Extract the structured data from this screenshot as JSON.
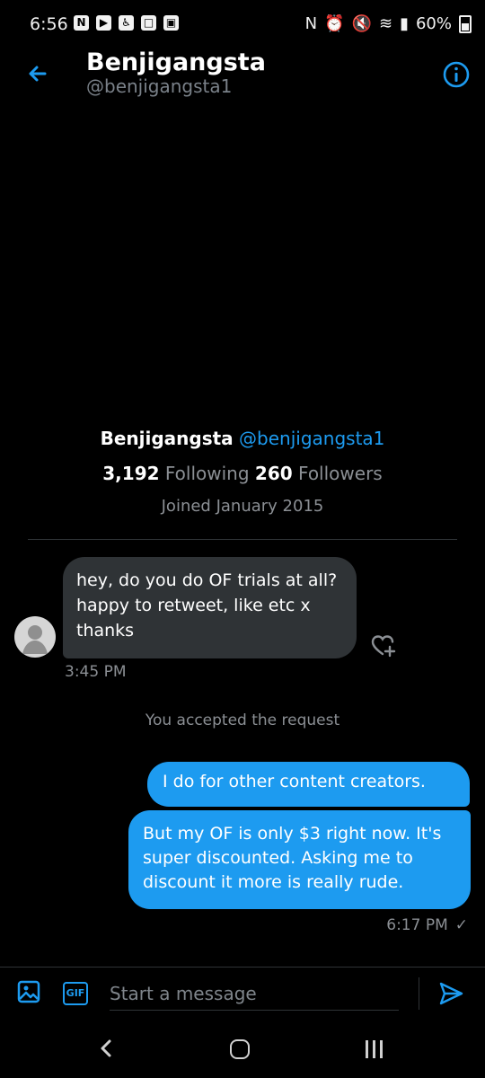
{
  "status_bar": {
    "time": "6:56",
    "battery": "60%"
  },
  "header": {
    "title": "Benjigangsta",
    "handle": "@benjigangsta1"
  },
  "profile": {
    "name": "Benjigangsta",
    "handle": "@benjigangsta1",
    "following_count": "3,192",
    "following_label": "Following",
    "followers_count": "260",
    "followers_label": "Followers",
    "joined": "Joined January 2015"
  },
  "messages": {
    "incoming": {
      "text": "hey, do you do OF trials at all? happy to retweet, like etc x thanks",
      "time": "3:45 PM"
    },
    "system": "You accepted the request",
    "outgoing_1": "I do for other content creators.",
    "outgoing_2": "But my OF is only $3 right now. It's super discounted. Asking me to discount it more is really rude.",
    "outgoing_time": "6:17 PM"
  },
  "composer": {
    "placeholder": "Start a message",
    "gif_label": "GIF"
  },
  "colors": {
    "accent": "#1d9bf0",
    "background": "#000000",
    "bubble_incoming": "#2f3336",
    "muted_text": "#8b8f94"
  }
}
